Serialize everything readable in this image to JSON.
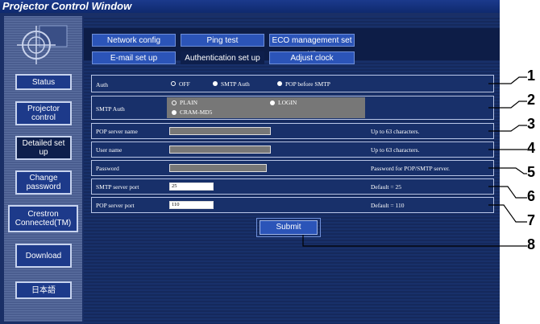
{
  "window": {
    "title": "Projector Control Window"
  },
  "sidebar": {
    "items": [
      {
        "label": "Status"
      },
      {
        "label": "Projector control"
      },
      {
        "label": "Detailed set up"
      },
      {
        "label": "Change password"
      },
      {
        "label": "Crestron Connected(TM)"
      },
      {
        "label": "Download"
      },
      {
        "label": "日本語"
      }
    ]
  },
  "tabs": [
    {
      "label": "Network config"
    },
    {
      "label": "Ping test"
    },
    {
      "label": "ECO management set up"
    },
    {
      "label": "E-mail set up"
    },
    {
      "label": "Authentication set up"
    },
    {
      "label": "Adjust clock"
    }
  ],
  "form": {
    "auth": {
      "label": "Auth",
      "options": [
        "OFF",
        "SMTP Auth",
        "POP before SMTP"
      ],
      "selected": "OFF"
    },
    "smtp_auth": {
      "label": "SMTP Auth",
      "options": [
        "PLAIN",
        "LOGIN",
        "CRAM-MD5"
      ],
      "selected": "PLAIN"
    },
    "pop_server_name": {
      "label": "POP server name",
      "hint": "Up to 63 characters."
    },
    "user_name": {
      "label": "User name",
      "hint": "Up to 63 characters."
    },
    "password": {
      "label": "Password",
      "hint": "Password for POP/SMTP server."
    },
    "smtp_port": {
      "label": "SMTP server port",
      "value": "25",
      "hint": "Default = 25"
    },
    "pop_port": {
      "label": "POP server port",
      "value": "110",
      "hint": "Default = 110"
    },
    "submit_label": "Submit"
  },
  "callouts": [
    "1",
    "2",
    "3",
    "4",
    "5",
    "6",
    "7",
    "8"
  ]
}
